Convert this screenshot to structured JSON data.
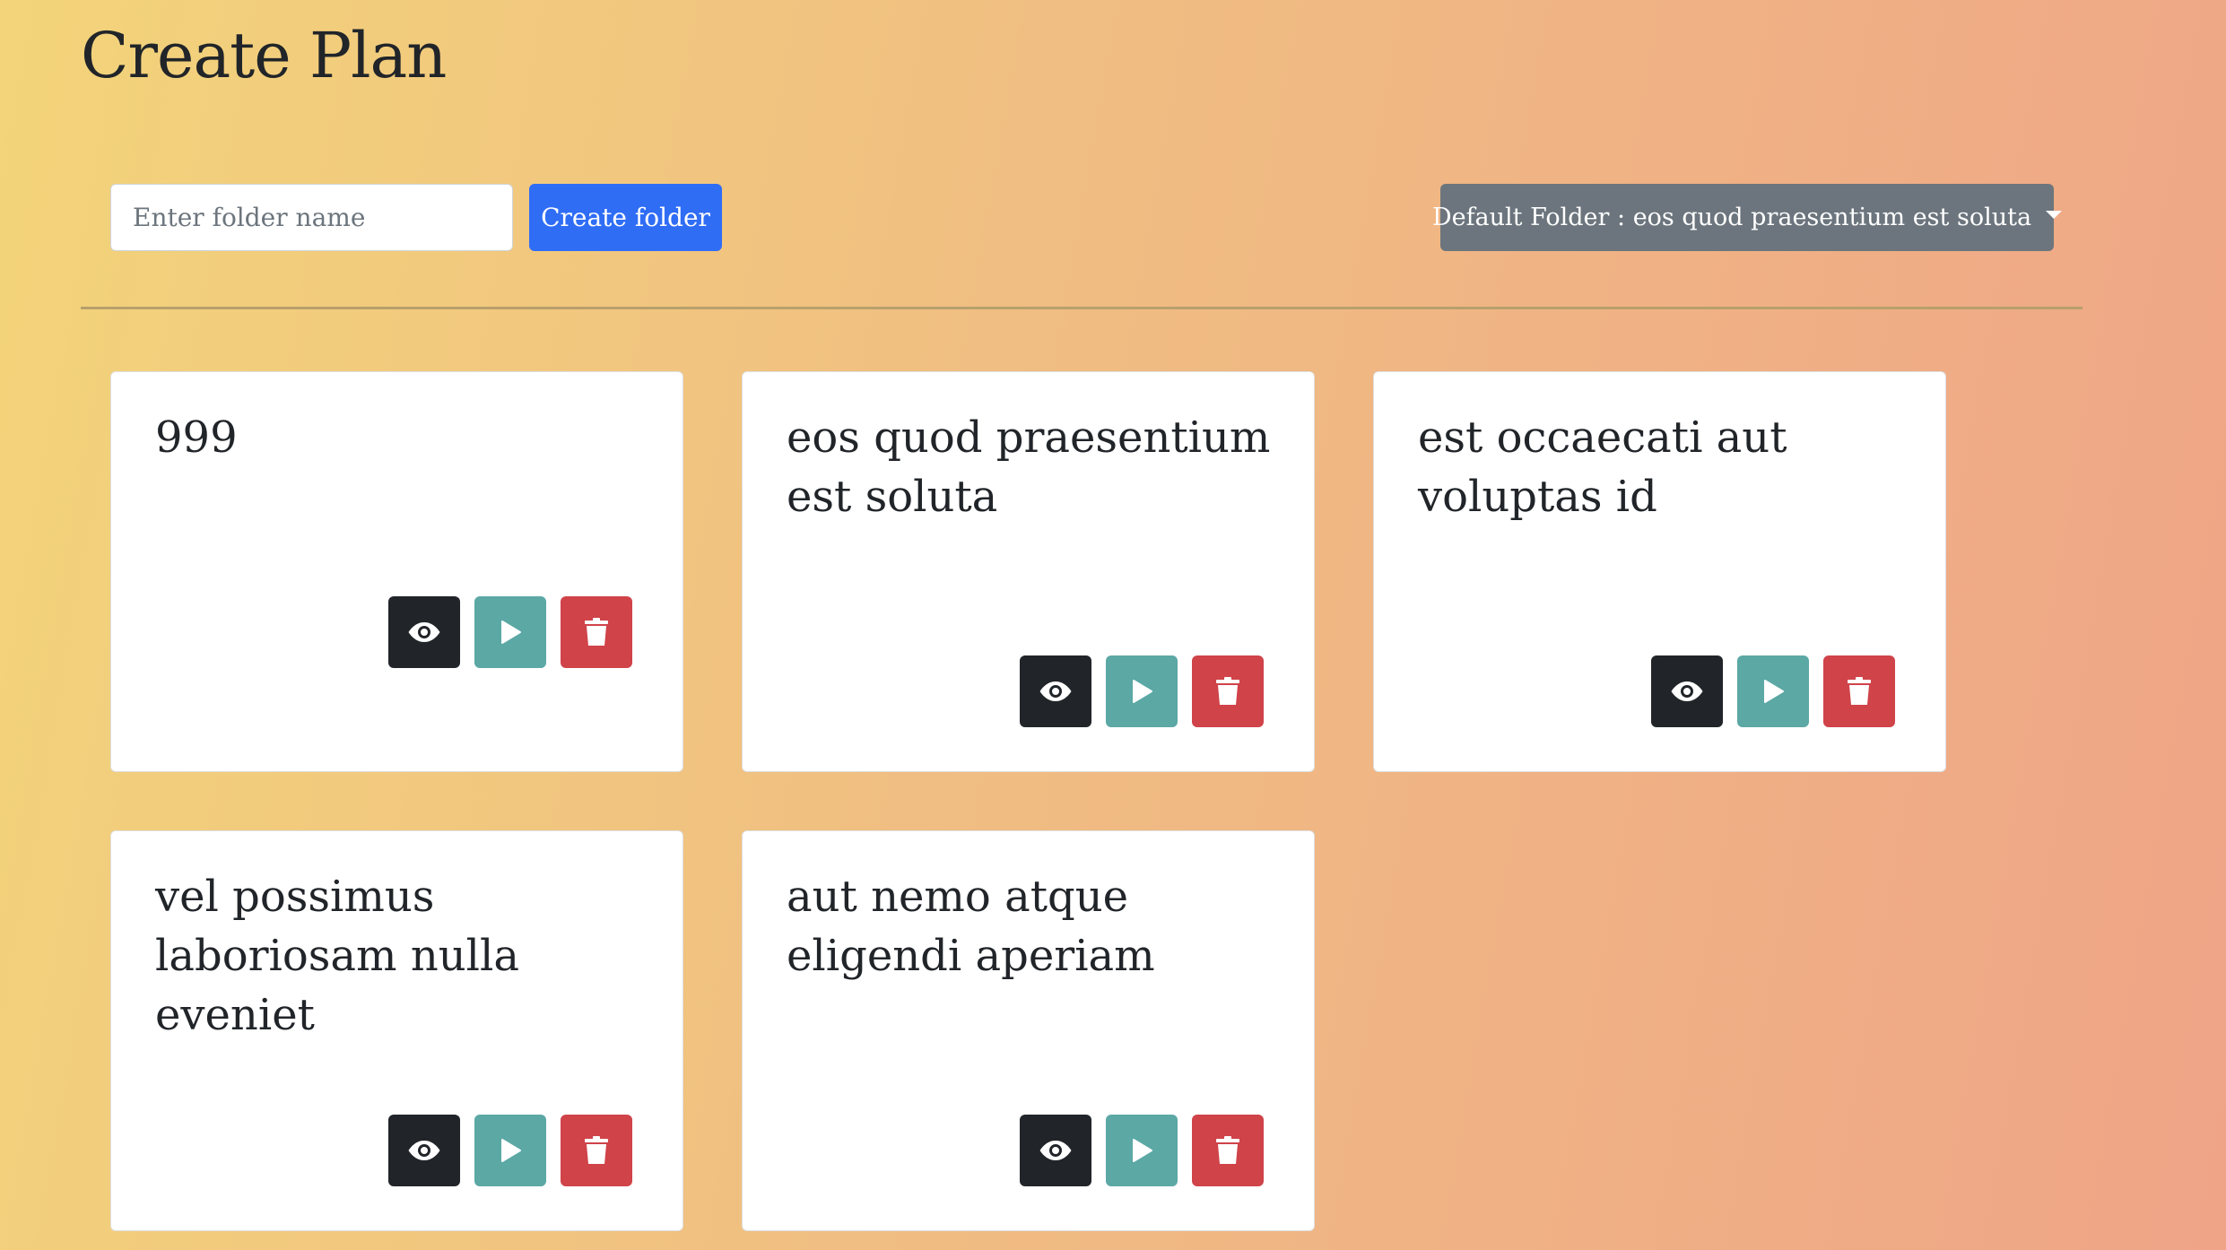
{
  "page": {
    "title": "Create Plan"
  },
  "toolbar": {
    "folder_input_placeholder": "Enter folder name",
    "folder_input_value": "",
    "create_button_label": "Create folder",
    "folder_dropdown_label": "Default Folder : eos quod praesentium est soluta"
  },
  "plans": [
    {
      "title": "999"
    },
    {
      "title": "eos quod praesentium est soluta"
    },
    {
      "title": "est occaecati aut voluptas id"
    },
    {
      "title": "vel possimus laboriosam nulla eveniet"
    },
    {
      "title": "aut nemo atque eligendi aperiam"
    }
  ],
  "actions": {
    "view_icon": "eye-icon",
    "play_icon": "play-icon",
    "delete_icon": "trash-icon"
  },
  "colors": {
    "primary": "#2f6df5",
    "secondary": "#6c757d",
    "view": "#212529",
    "play": "#5ba8a5",
    "delete": "#cf4349"
  }
}
